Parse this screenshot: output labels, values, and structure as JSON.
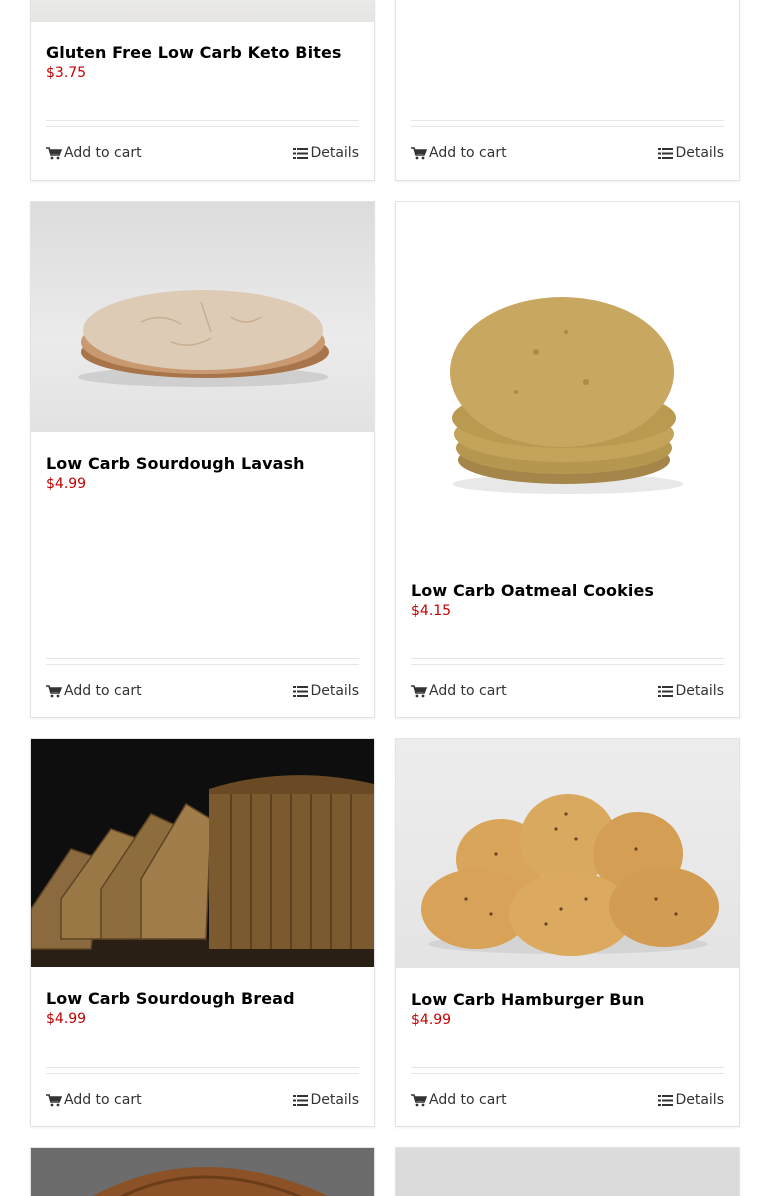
{
  "actions": {
    "add_to_cart": "Add to cart",
    "details": "Details"
  },
  "colors": {
    "price": "#c60000",
    "border": "#e3e3e3"
  },
  "icons": {
    "add": "cart-icon",
    "details": "list-icon"
  },
  "products": [
    {
      "name": "Gluten Free Low Carb Keto Bites",
      "price": "$3.75"
    },
    {
      "name": "",
      "price": ""
    },
    {
      "name": "Low Carb Sourdough Lavash",
      "price": "$4.99"
    },
    {
      "name": "Low Carb Oatmeal Cookies",
      "price": "$4.15"
    },
    {
      "name": "Low Carb Sourdough Bread",
      "price": "$4.99"
    },
    {
      "name": "Low Carb Hamburger Bun",
      "price": "$4.99"
    }
  ]
}
